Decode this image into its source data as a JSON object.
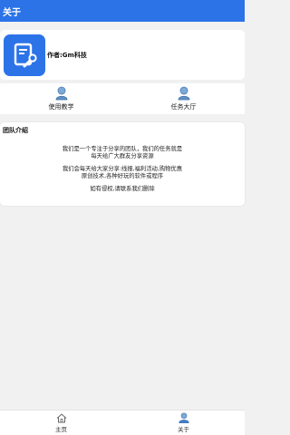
{
  "header": {
    "title": "关于"
  },
  "profile": {
    "author": "作者:Gm科技",
    "logo_icon": "wrench-document-icon",
    "accent": "#2c73e8"
  },
  "quick_links": [
    {
      "label": "使用教学",
      "icon": "user-icon"
    },
    {
      "label": "任务大厅",
      "icon": "user-icon"
    }
  ],
  "team": {
    "title": "团队介绍",
    "paragraphs": [
      [
        "我们是一个专注于分享的团队，我们的任务就是",
        "每天给广大群友分享资源"
      ],
      [
        "我们会每天给大家分享:线报,福利活动,购物优惠",
        "原创技术,各种好玩的软件或程序"
      ],
      [
        "如有侵权,请联系我们删除"
      ]
    ]
  },
  "bottom_nav": [
    {
      "label": "主页",
      "icon": "home-icon",
      "active": false
    },
    {
      "label": "关于",
      "icon": "user-icon",
      "active": true
    }
  ]
}
